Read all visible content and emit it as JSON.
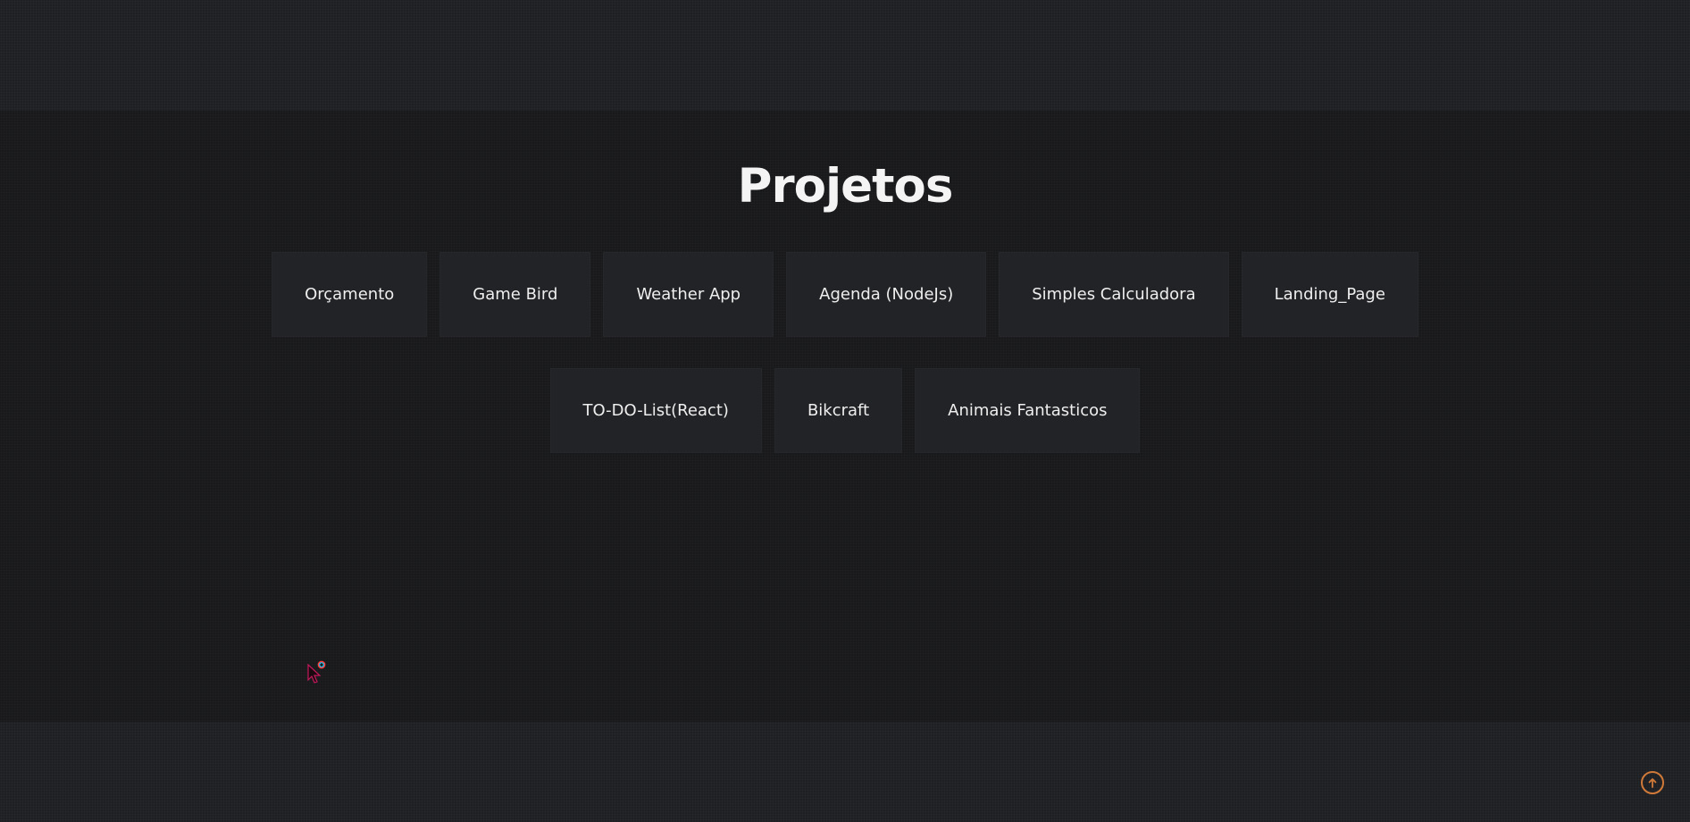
{
  "section": {
    "title": "Projetos"
  },
  "projects": {
    "row1": [
      "Orçamento",
      "Game Bird",
      "Weather App",
      "Agenda (NodeJs)",
      "Simples Calculadora",
      "Landing_Page"
    ],
    "row2": [
      "TO-DO-List(React)",
      "Bikcraft",
      "Animais Fantasticos"
    ]
  },
  "icons": {
    "back_to_top": "arrow-up-circle-icon",
    "cursor": "mouse-pointer-icon"
  },
  "colors": {
    "background": "#18191b",
    "card": "#222326",
    "text": "#f4f4f4",
    "accent": "#d07a3a"
  }
}
